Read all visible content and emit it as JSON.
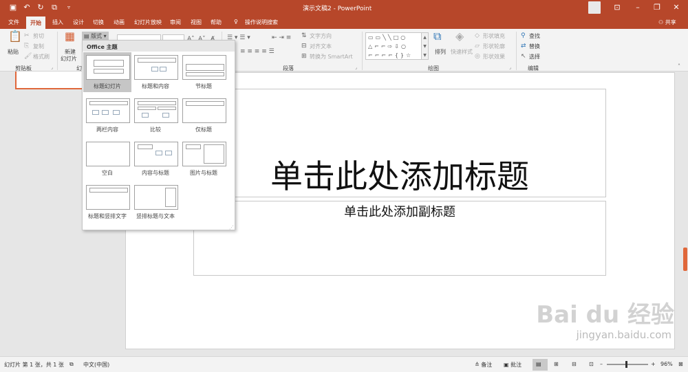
{
  "window": {
    "title": "演示文稿2 - PowerPoint",
    "share": "共享"
  },
  "quick_access": {
    "save": "💾",
    "undo": "↶",
    "redo": "↷"
  },
  "tabs": [
    "文件",
    "开始",
    "插入",
    "设计",
    "切换",
    "动画",
    "幻灯片放映",
    "审阅",
    "视图",
    "帮助"
  ],
  "tell_me": "操作说明搜索",
  "ribbon": {
    "clipboard": {
      "paste": "粘贴",
      "cut": "剪切",
      "copy": "复制",
      "format_painter": "格式刷",
      "group": "剪贴板"
    },
    "slides": {
      "new_slide": "新建\n幻灯片",
      "new_slide_label": "新建",
      "new_slide_label2": "幻灯片",
      "layout": "版式",
      "group_partial": "幻"
    },
    "paragraph": {
      "text_direction": "文字方向",
      "align_text": "对齐文本",
      "smartart": "转换为 SmartArt",
      "group": "段落"
    },
    "drawing": {
      "arrange": "排列",
      "quick_styles": "快速样式",
      "shape_fill": "形状填充",
      "shape_outline": "形状轮廓",
      "shape_effects": "形状效果",
      "group": "绘图"
    },
    "editing": {
      "find": "查找",
      "replace": "替换",
      "select": "选择",
      "group": "编辑"
    }
  },
  "layout_menu": {
    "header": "Office 主题",
    "items": [
      "标题幻灯片",
      "标题和内容",
      "节标题",
      "两栏内容",
      "比较",
      "仅标题",
      "空白",
      "内容与标题",
      "图片与标题",
      "标题和竖排文字",
      "竖排标题与文本"
    ]
  },
  "slide": {
    "title_placeholder": "单击此处添加标题",
    "subtitle_placeholder": "单击此处添加副标题"
  },
  "status": {
    "slide_info": "幻灯片 第 1 张，共 1 张",
    "language": "中文(中国)",
    "notes": "备注",
    "comments": "批注",
    "zoom": "96%"
  },
  "watermark": {
    "brand": "Bai du 经验",
    "url": "jingyan.baidu.com"
  }
}
